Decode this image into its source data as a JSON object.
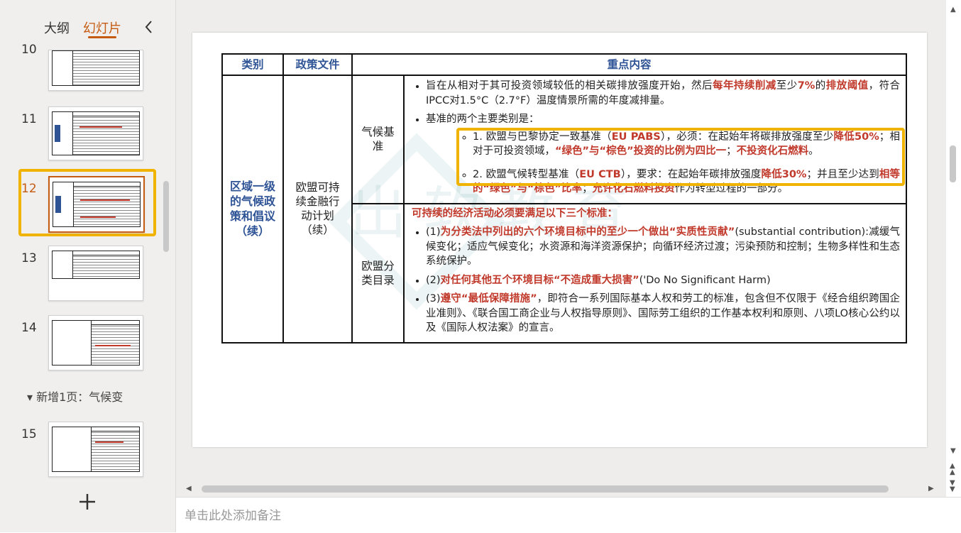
{
  "sidebar": {
    "tabs": [
      {
        "label": "大纲",
        "active": false
      },
      {
        "label": "幻灯片",
        "active": true
      }
    ],
    "thumbnails": [
      {
        "number": "10",
        "selected": false
      },
      {
        "number": "11",
        "selected": false
      },
      {
        "number": "12",
        "selected": true
      },
      {
        "number": "13",
        "selected": false
      },
      {
        "number": "14",
        "selected": false
      },
      {
        "number": "15",
        "selected": false
      }
    ],
    "section_label": "新增1页：气候变",
    "add_icon": "plus-icon",
    "accent_color": "#c55a11",
    "selection_color": "#f0b400"
  },
  "slide": {
    "headers": [
      "类别",
      "政策文件",
      "重点内容"
    ],
    "category": "区域一级的气候政策和倡议（续）",
    "policy": "欧盟可持续金融行动计划（续）",
    "climate_benchmark": {
      "label": "气候基准",
      "b1_pre": "旨在从相对于其可投资领域较低的相关碳排放强度开始，然后",
      "b1_red1": "每年持续削减",
      "b1_mid": "至少",
      "b1_red2": "7%",
      "b1_mid2": "的",
      "b1_red3": "排放阈值",
      "b1_post": "，符合IPCC对1.5°C（2.7°F）温度情景所需的年度减排量。",
      "b2": "基准的两个主要类别是：",
      "s1_pre": "1. 欧盟与巴黎协定一致基准（",
      "s1_red1": "EU PABS",
      "s1_mid1": "），必须：在起始年将碳排放强度至少",
      "s1_red2": "降低50%",
      "s1_mid2": "；相对于可投资领域，",
      "s1_red3": "“绿色”与“棕色”投资的比例为四比一",
      "s1_mid3": "；",
      "s1_red4": "不投资化石燃料",
      "s1_post": "。",
      "s2_pre": "2. 欧盟气候转型基准（",
      "s2_red1": "EU CTB",
      "s2_mid1": "），要求：在起始年碳排放强度",
      "s2_red2": "降低30%",
      "s2_mid2": "；并且至少达到",
      "s2_red3": "相等的“绿色”与“棕色”比率",
      "s2_mid3": "；",
      "s2_red4": "允许化石燃料投资",
      "s2_post": "作为转型过程的一部分。"
    },
    "taxonomy": {
      "label": "欧盟分类目录",
      "title": "可持续的经济活动必须要满足以下三个标准：",
      "c1_pre": "(1)",
      "c1_red": "为分类法中列出的六个环境目标中的至少一个做出“实质性贡献”",
      "c1_post": "(substantial contribution):减缓气候变化；适应气候变化；水资源和海洋资源保护；向循环经济过渡；污染预防和控制；生物多样性和生态系统保护。",
      "c2_pre": "(2)",
      "c2_red": "对任何其他五个环境目标“不造成重大损害”",
      "c2_post": "('Do No Significant Harm)",
      "c3_pre": "(3)",
      "c3_red": "遵守“最低保障措施”",
      "c3_post": "，即符合一系列国际基本人权和劳工的标准，包含但不仅限于《经合组织跨国企业准则》、《联合国工商企业与人权指导原则》、国际劳工组织的工作基本权利和原则、八项LO核心公约以及《国际人权法案》的宣言。"
    },
    "watermark": "出软教育",
    "header_color": "#2f5496",
    "emphasis_color": "#c0392b"
  },
  "notes": {
    "placeholder": "单击此处添加备注"
  }
}
